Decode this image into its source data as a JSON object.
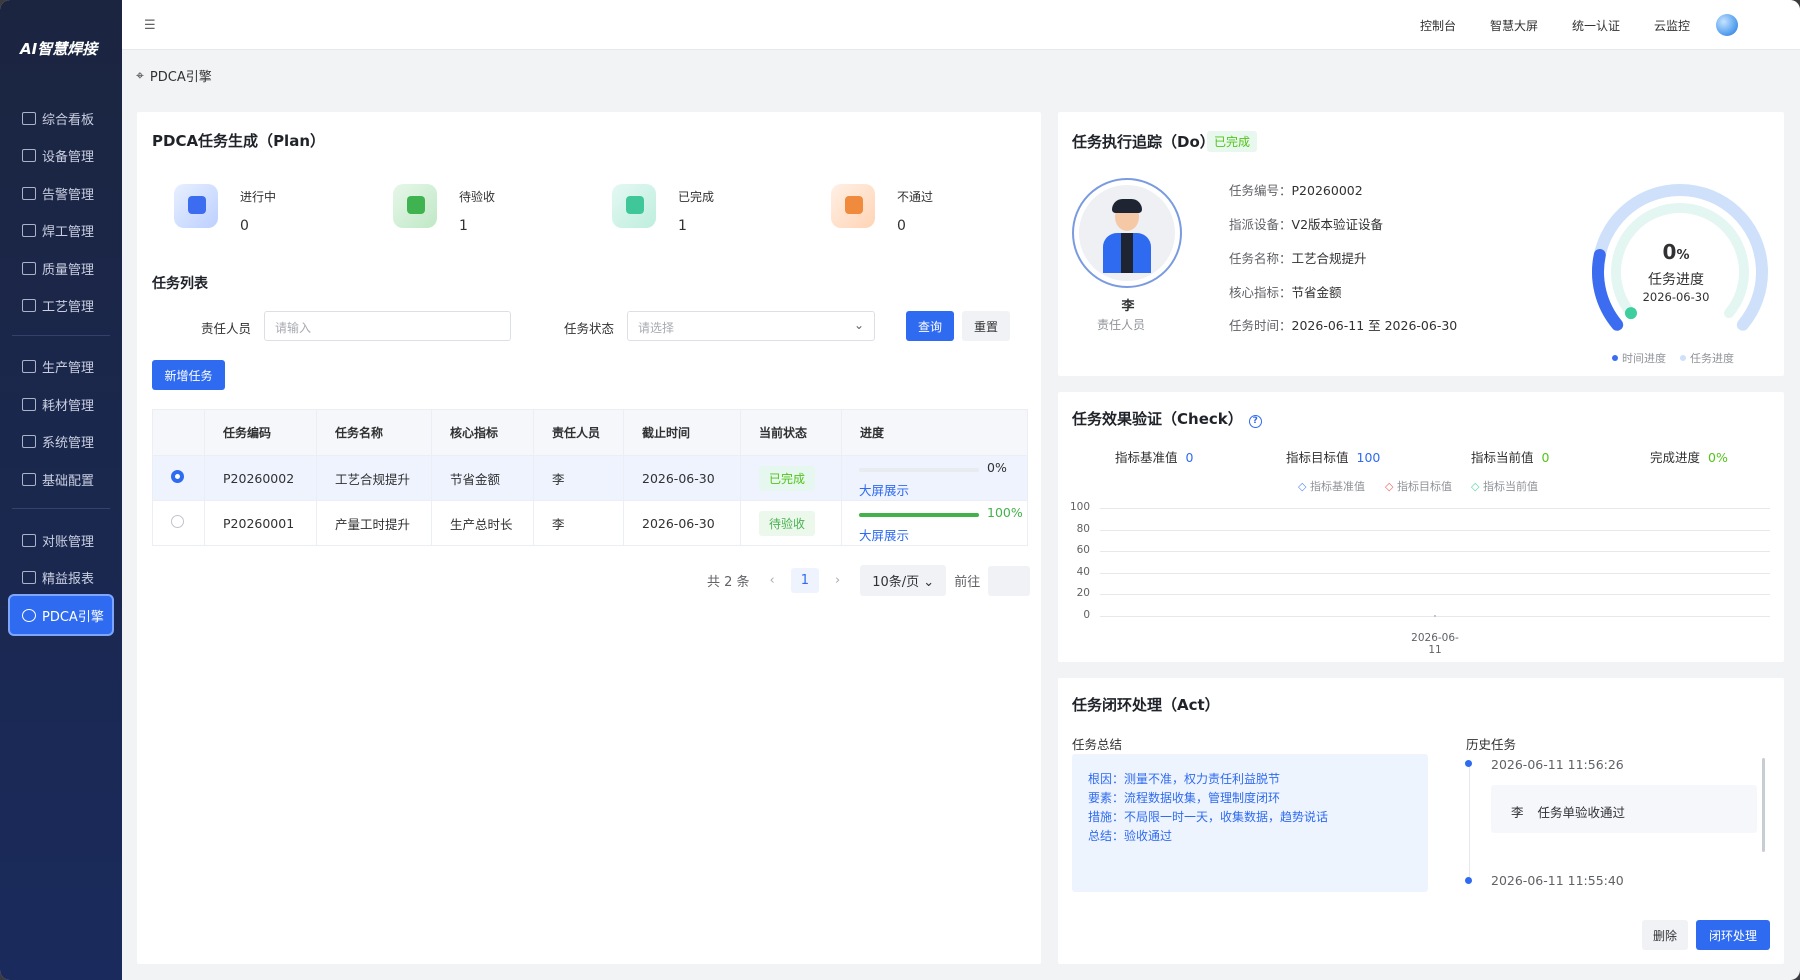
{
  "app": {
    "logo": "AI智慧焊接"
  },
  "sidebar": {
    "items": [
      {
        "label": "综合看板"
      },
      {
        "label": "设备管理"
      },
      {
        "label": "告警管理"
      },
      {
        "label": "焊工管理"
      },
      {
        "label": "质量管理"
      },
      {
        "label": "工艺管理"
      },
      {
        "label": "生产管理"
      },
      {
        "label": "耗材管理"
      },
      {
        "label": "系统管理"
      },
      {
        "label": "基础配置"
      },
      {
        "label": "对账管理"
      },
      {
        "label": "精益报表"
      },
      {
        "label": "PDCA引擎"
      }
    ]
  },
  "topbar": {
    "links": [
      "控制台",
      "智慧大屏",
      "统一认证",
      "云监控"
    ]
  },
  "breadcrumb": {
    "label": "PDCA引擎"
  },
  "plan": {
    "title": "PDCA任务生成（Plan）",
    "stats": [
      {
        "label": "进行中",
        "value": "0"
      },
      {
        "label": "待验收",
        "value": "1"
      },
      {
        "label": "已完成",
        "value": "1"
      },
      {
        "label": "不通过",
        "value": "0"
      }
    ],
    "list_title": "任务列表",
    "filter": {
      "person_label": "责任人员",
      "person_placeholder": "请输入",
      "status_label": "任务状态",
      "status_placeholder": "请选择",
      "query": "查询",
      "reset": "重置"
    },
    "add_button": "新增任务",
    "columns": [
      "任务编码",
      "任务名称",
      "核心指标",
      "责任人员",
      "截止时间",
      "当前状态",
      "进度"
    ],
    "rows": [
      {
        "code": "P20260002",
        "name": "工艺合规提升",
        "metric": "节省金额",
        "person": "李",
        "deadline": "2026-06-30",
        "status": "已完成",
        "progress": 0,
        "progress_text": "0%",
        "link": "大屏展示"
      },
      {
        "code": "P20260001",
        "name": "产量工时提升",
        "metric": "生产总时长",
        "person": "李",
        "deadline": "2026-06-30",
        "status": "待验收",
        "progress": 100,
        "progress_text": "100%",
        "link": "大屏展示"
      }
    ],
    "pager": {
      "total": "共 2 条",
      "page": "1",
      "size": "10条/页",
      "goto": "前往"
    }
  },
  "do": {
    "title": "任务执行追踪（Do）",
    "badge": "已完成",
    "person_name": "李",
    "person_role": "责任人员",
    "fields": [
      {
        "k": "任务编号：",
        "v": "P20260002"
      },
      {
        "k": "指派设备：",
        "v": "V2版本验证设备"
      },
      {
        "k": "任务名称：",
        "v": "工艺合规提升"
      },
      {
        "k": "核心指标：",
        "v": "节省金额"
      },
      {
        "k": "任务时间：",
        "v": "2026-06-11 至 2026-06-30"
      }
    ],
    "gauge": {
      "value": "0",
      "unit": "%",
      "label": "任务进度",
      "date": "2026-06-30",
      "time_progress": 0.2,
      "task_progress": 0
    },
    "legend": [
      "时间进度",
      "任务进度"
    ]
  },
  "check": {
    "title": "任务效果验证（Check）",
    "metrics": [
      {
        "label": "指标基准值",
        "value": "0"
      },
      {
        "label": "指标目标值",
        "value": "100"
      },
      {
        "label": "指标当前值",
        "value": "0"
      },
      {
        "label": "完成进度",
        "value": "0%"
      }
    ],
    "chart_data": {
      "type": "line",
      "x": [
        "2026-06-11"
      ],
      "series": [
        {
          "name": "指标基准值",
          "values": [
            0
          ]
        },
        {
          "name": "指标目标值",
          "values": [
            0
          ]
        },
        {
          "name": "指标当前值",
          "values": [
            0
          ]
        }
      ],
      "yticks": [
        "100",
        "80",
        "60",
        "40",
        "20",
        "0"
      ],
      "ylim": [
        0,
        100
      ],
      "grid": true,
      "legend": "top-center"
    }
  },
  "act": {
    "title": "任务闭环处理（Act）",
    "summary_title": "任务总结",
    "summary": [
      {
        "k": "根因：",
        "v": "测量不准，权力责任利益脱节"
      },
      {
        "k": "要素：",
        "v": "流程数据收集，管理制度闭环"
      },
      {
        "k": "措施：",
        "v": "不局限一时一天，收集数据，趋势说话"
      },
      {
        "k": "总结：",
        "v": "验收通过"
      }
    ],
    "history_title": "历史任务",
    "history": [
      {
        "time": "2026-06-11 11:56:26",
        "person": "李",
        "text": "任务单验收通过"
      },
      {
        "time": "2026-06-11 11:55:40"
      }
    ],
    "delete": "删除",
    "close": "闭环处理"
  },
  "colors": {
    "primary": "#2f6bf0",
    "success": "#52c41a",
    "sidebar": "#1b2540"
  }
}
